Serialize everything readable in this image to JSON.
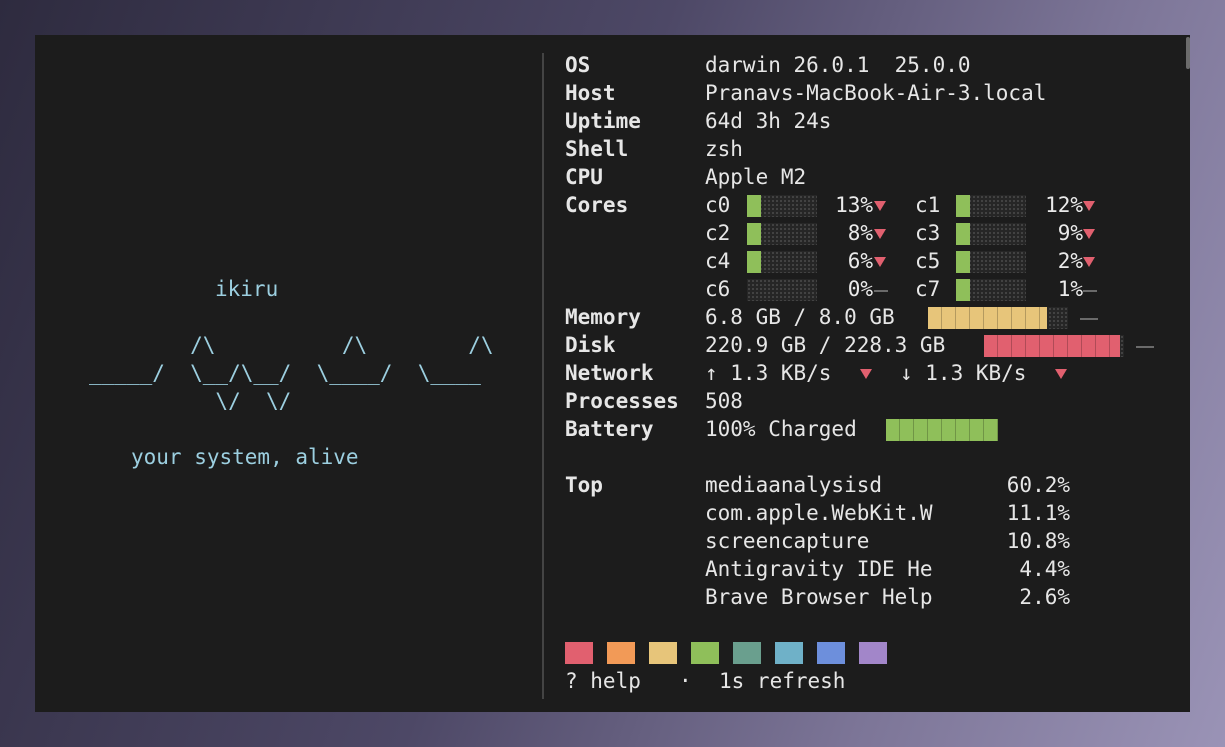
{
  "colors": {
    "label": "#b49bd4",
    "ascii": "#9ccfe0",
    "core_bar": "#8fbf5a",
    "memory_bar": "#e7c57a",
    "disk_bar": "#e1606f",
    "battery_bar": "#8fbf5a",
    "down_arrow": "#e1606f"
  },
  "logo": {
    "name": "ikiru",
    "art_line1": "        /\\          /\\        /\\",
    "art_line2": "_____/  \\__/\\__/  \\____/  \\____",
    "art_line3": "          \\/  \\/",
    "tagline": "your system, alive"
  },
  "info": {
    "os": {
      "label": "OS",
      "value": "darwin 26.0.1  25.0.0"
    },
    "host": {
      "label": "Host",
      "value": "Pranavs-MacBook-Air-3.local"
    },
    "uptime": {
      "label": "Uptime",
      "value": "64d 3h 24s"
    },
    "shell": {
      "label": "Shell",
      "value": "zsh"
    },
    "cpu": {
      "label": "CPU",
      "value": "Apple M2"
    },
    "cores_label": "Cores",
    "cores": [
      {
        "name": "c0",
        "pct": "13%",
        "value": 0.13,
        "trend": "down"
      },
      {
        "name": "c1",
        "pct": "12%",
        "value": 0.12,
        "trend": "down"
      },
      {
        "name": "c2",
        "pct": "8%",
        "value": 0.08,
        "trend": "down"
      },
      {
        "name": "c3",
        "pct": "9%",
        "value": 0.09,
        "trend": "down"
      },
      {
        "name": "c4",
        "pct": "6%",
        "value": 0.06,
        "trend": "down"
      },
      {
        "name": "c5",
        "pct": "2%",
        "value": 0.02,
        "trend": "down"
      },
      {
        "name": "c6",
        "pct": "0%",
        "value": 0.0,
        "trend": "flat"
      },
      {
        "name": "c7",
        "pct": "1%",
        "value": 0.01,
        "trend": "flat"
      }
    ],
    "memory": {
      "label": "Memory",
      "value": "6.8 GB / 8.0 GB",
      "fraction": 0.85
    },
    "disk": {
      "label": "Disk",
      "value": "220.9 GB / 228.3 GB",
      "fraction": 0.97
    },
    "network": {
      "label": "Network",
      "up_value": "↑ 1.3 KB/s",
      "down_value": "↓ 1.3 KB/s"
    },
    "processes": {
      "label": "Processes",
      "value": "508"
    },
    "battery": {
      "label": "Battery",
      "value": "100% Charged",
      "fraction": 1.0
    },
    "top_label": "Top",
    "top": [
      {
        "name": "mediaanalysisd",
        "pct": "60.2%"
      },
      {
        "name": "com.apple.WebKit.W",
        "pct": "11.1%"
      },
      {
        "name": "screencapture",
        "pct": "10.8%"
      },
      {
        "name": "Antigravity IDE He",
        "pct": "4.4%"
      },
      {
        "name": "Brave Browser Help",
        "pct": "2.6%"
      }
    ]
  },
  "palette": [
    "#e1606f",
    "#f29a57",
    "#e7c57a",
    "#8fbf5a",
    "#6a9f8e",
    "#6fb1c8",
    "#6d8fdc",
    "#a286c9"
  ],
  "footer": {
    "help": "? help",
    "sep": "·",
    "refresh": "1s refresh"
  }
}
